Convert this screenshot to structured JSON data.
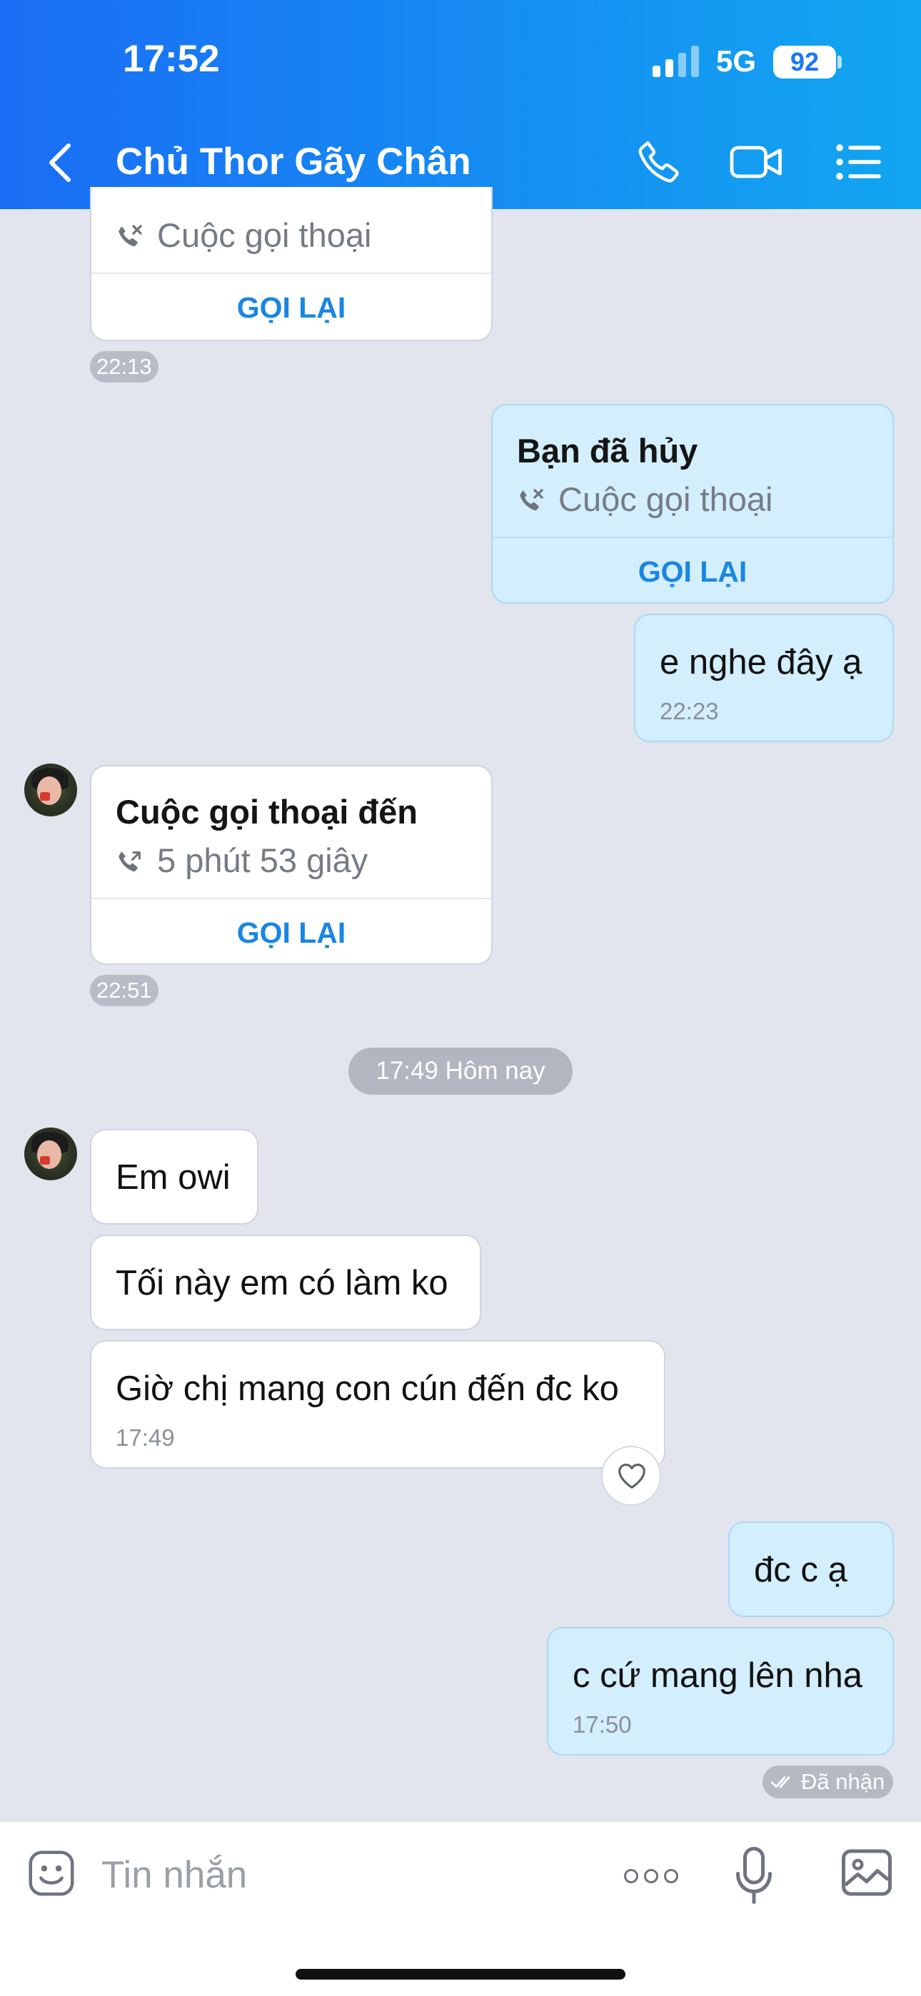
{
  "status_bar": {
    "time": "17:52",
    "network": "5G",
    "battery": "92"
  },
  "header": {
    "title": "Chủ Thor Gãy Chân"
  },
  "messages": {
    "m1": {
      "subtitle": "Cuộc gọi thoại",
      "button": "GỌI LẠI",
      "time": "22:13"
    },
    "m2": {
      "title": "Bạn đã hủy",
      "subtitle": "Cuộc gọi thoại",
      "button": "GỌI LẠI"
    },
    "m3": {
      "text": "e nghe đây ạ",
      "time": "22:23"
    },
    "m4": {
      "title": "Cuộc gọi thoại đến",
      "subtitle": "5 phút 53 giây",
      "button": "GỌI LẠI",
      "time": "22:51"
    },
    "date_divider": "17:49 Hôm nay",
    "m5": {
      "text": "Em owi"
    },
    "m6": {
      "text": "Tối này em có làm ko"
    },
    "m7": {
      "text": "Giờ chị mang con cún đến đc ko",
      "time": "17:49"
    },
    "m8": {
      "text": "đc c ạ"
    },
    "m9": {
      "text": "c cứ mang lên nha",
      "time": "17:50"
    },
    "delivery_status": "Đã nhận"
  },
  "composer": {
    "placeholder": "Tin nhắn"
  },
  "colors": {
    "header_start": "#1a6df5",
    "header_end": "#12a6f0",
    "accent": "#1a86e2",
    "sent_bubble": "#d3eefc"
  },
  "icons": [
    "back-icon",
    "phone-icon",
    "video-call-icon",
    "menu-list-icon",
    "missed-call-icon",
    "call-icon",
    "heart-icon",
    "sticker-icon",
    "more-icon",
    "microphone-icon",
    "image-icon"
  ]
}
